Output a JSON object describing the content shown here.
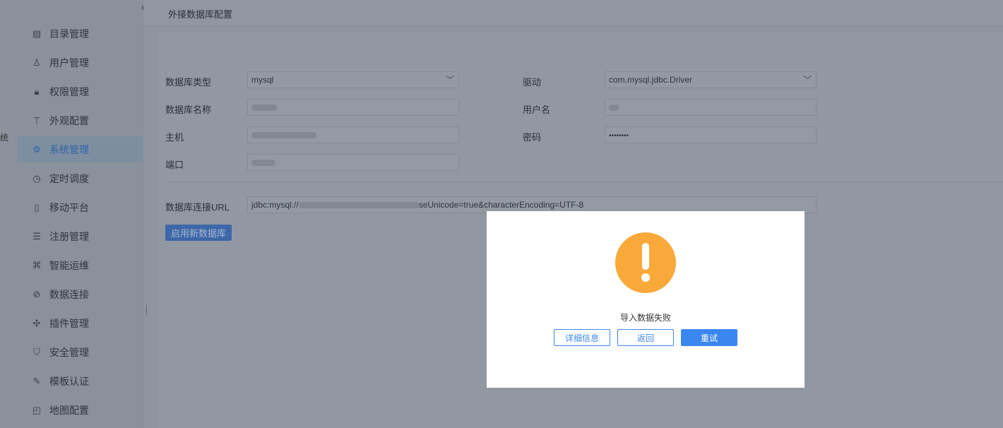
{
  "left_strip": {
    "partial_label": "统"
  },
  "sidebar": {
    "items": [
      {
        "label": "目录管理",
        "icon": "catalog-icon"
      },
      {
        "label": "用户管理",
        "icon": "user-icon"
      },
      {
        "label": "权限管理",
        "icon": "lock-icon"
      },
      {
        "label": "外观配置",
        "icon": "paint-roller-icon"
      },
      {
        "label": "系统管理",
        "icon": "gear-icon",
        "active": true
      },
      {
        "label": "定时调度",
        "icon": "timer-icon"
      },
      {
        "label": "移动平台",
        "icon": "mobile-icon"
      },
      {
        "label": "注册管理",
        "icon": "register-icon"
      },
      {
        "label": "智能运维",
        "icon": "network-icon"
      },
      {
        "label": "数据连接",
        "icon": "paperclip-icon"
      },
      {
        "label": "插件管理",
        "icon": "puzzle-icon"
      },
      {
        "label": "安全管理",
        "icon": "shield-icon"
      },
      {
        "label": "模板认证",
        "icon": "template-auth-icon"
      },
      {
        "label": "地图配置",
        "icon": "map-icon"
      }
    ]
  },
  "header": {
    "title": "外接数据库配置"
  },
  "form": {
    "db_type_label": "数据库类型",
    "db_type_value": "mysql",
    "driver_label": "驱动",
    "driver_value": "com.mysql.jdbc.Driver",
    "db_name_label": "数据库名称",
    "username_label": "用户名",
    "host_label": "主机",
    "password_label": "密码",
    "password_value": "••••••••",
    "port_label": "端口",
    "url_label": "数据库连接URL",
    "url_prefix": "jdbc:mysql://",
    "url_suffix": "seUnicode=true&characterEncoding=UTF-8",
    "enable_button": "启用新数据库"
  },
  "dialog": {
    "message": "导入数据失败",
    "details_button": "详细信息",
    "back_button": "返回",
    "retry_button": "重试",
    "warning_color": "#f9a93a",
    "accent_color": "#3b87f0"
  }
}
